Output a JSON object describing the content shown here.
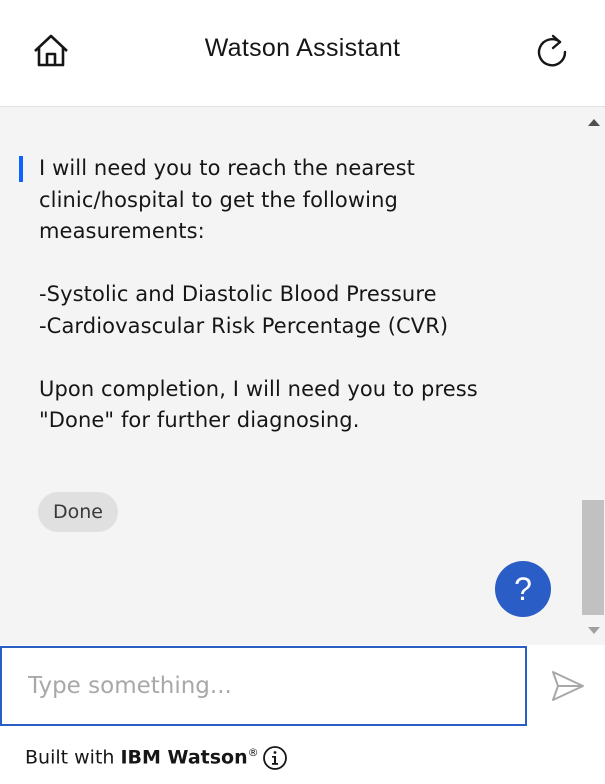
{
  "header": {
    "title": "Watson Assistant",
    "home_icon": "home-icon",
    "restart_icon": "restart-icon"
  },
  "message": {
    "text": "I will need you to reach the nearest\nclinic/hospital to get the following\nmeasurements:\n\n-Systolic and Diastolic Blood Pressure\n-Cardiovascular Risk Percentage (CVR)\n\nUpon completion, I will need you to press\n\"Done\" for further diagnosing.",
    "accent_color": "#0f62fe"
  },
  "options": {
    "done_label": "Done"
  },
  "help": {
    "label": "?",
    "color": "#2b5dc7"
  },
  "input": {
    "placeholder": "Type something...",
    "value": ""
  },
  "footer": {
    "prefix": "Built with ",
    "brand": "IBM Watson",
    "mark": "®"
  }
}
